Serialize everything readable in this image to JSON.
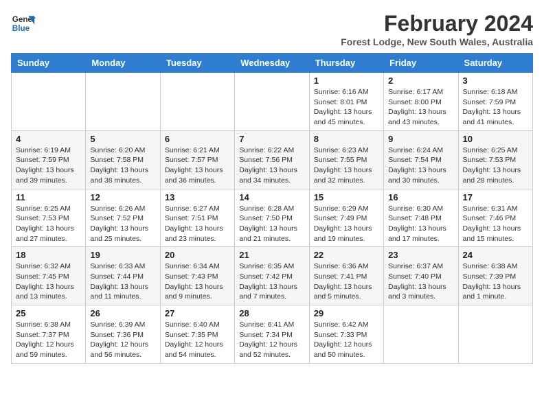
{
  "logo": {
    "line1": "General",
    "line2": "Blue"
  },
  "title": "February 2024",
  "location": "Forest Lodge, New South Wales, Australia",
  "weekdays": [
    "Sunday",
    "Monday",
    "Tuesday",
    "Wednesday",
    "Thursday",
    "Friday",
    "Saturday"
  ],
  "weeks": [
    [
      {
        "day": "",
        "info": ""
      },
      {
        "day": "",
        "info": ""
      },
      {
        "day": "",
        "info": ""
      },
      {
        "day": "",
        "info": ""
      },
      {
        "day": "1",
        "info": "Sunrise: 6:16 AM\nSunset: 8:01 PM\nDaylight: 13 hours\nand 45 minutes."
      },
      {
        "day": "2",
        "info": "Sunrise: 6:17 AM\nSunset: 8:00 PM\nDaylight: 13 hours\nand 43 minutes."
      },
      {
        "day": "3",
        "info": "Sunrise: 6:18 AM\nSunset: 7:59 PM\nDaylight: 13 hours\nand 41 minutes."
      }
    ],
    [
      {
        "day": "4",
        "info": "Sunrise: 6:19 AM\nSunset: 7:59 PM\nDaylight: 13 hours\nand 39 minutes."
      },
      {
        "day": "5",
        "info": "Sunrise: 6:20 AM\nSunset: 7:58 PM\nDaylight: 13 hours\nand 38 minutes."
      },
      {
        "day": "6",
        "info": "Sunrise: 6:21 AM\nSunset: 7:57 PM\nDaylight: 13 hours\nand 36 minutes."
      },
      {
        "day": "7",
        "info": "Sunrise: 6:22 AM\nSunset: 7:56 PM\nDaylight: 13 hours\nand 34 minutes."
      },
      {
        "day": "8",
        "info": "Sunrise: 6:23 AM\nSunset: 7:55 PM\nDaylight: 13 hours\nand 32 minutes."
      },
      {
        "day": "9",
        "info": "Sunrise: 6:24 AM\nSunset: 7:54 PM\nDaylight: 13 hours\nand 30 minutes."
      },
      {
        "day": "10",
        "info": "Sunrise: 6:25 AM\nSunset: 7:53 PM\nDaylight: 13 hours\nand 28 minutes."
      }
    ],
    [
      {
        "day": "11",
        "info": "Sunrise: 6:25 AM\nSunset: 7:53 PM\nDaylight: 13 hours\nand 27 minutes."
      },
      {
        "day": "12",
        "info": "Sunrise: 6:26 AM\nSunset: 7:52 PM\nDaylight: 13 hours\nand 25 minutes."
      },
      {
        "day": "13",
        "info": "Sunrise: 6:27 AM\nSunset: 7:51 PM\nDaylight: 13 hours\nand 23 minutes."
      },
      {
        "day": "14",
        "info": "Sunrise: 6:28 AM\nSunset: 7:50 PM\nDaylight: 13 hours\nand 21 minutes."
      },
      {
        "day": "15",
        "info": "Sunrise: 6:29 AM\nSunset: 7:49 PM\nDaylight: 13 hours\nand 19 minutes."
      },
      {
        "day": "16",
        "info": "Sunrise: 6:30 AM\nSunset: 7:48 PM\nDaylight: 13 hours\nand 17 minutes."
      },
      {
        "day": "17",
        "info": "Sunrise: 6:31 AM\nSunset: 7:46 PM\nDaylight: 13 hours\nand 15 minutes."
      }
    ],
    [
      {
        "day": "18",
        "info": "Sunrise: 6:32 AM\nSunset: 7:45 PM\nDaylight: 13 hours\nand 13 minutes."
      },
      {
        "day": "19",
        "info": "Sunrise: 6:33 AM\nSunset: 7:44 PM\nDaylight: 13 hours\nand 11 minutes."
      },
      {
        "day": "20",
        "info": "Sunrise: 6:34 AM\nSunset: 7:43 PM\nDaylight: 13 hours\nand 9 minutes."
      },
      {
        "day": "21",
        "info": "Sunrise: 6:35 AM\nSunset: 7:42 PM\nDaylight: 13 hours\nand 7 minutes."
      },
      {
        "day": "22",
        "info": "Sunrise: 6:36 AM\nSunset: 7:41 PM\nDaylight: 13 hours\nand 5 minutes."
      },
      {
        "day": "23",
        "info": "Sunrise: 6:37 AM\nSunset: 7:40 PM\nDaylight: 13 hours\nand 3 minutes."
      },
      {
        "day": "24",
        "info": "Sunrise: 6:38 AM\nSunset: 7:39 PM\nDaylight: 13 hours\nand 1 minute."
      }
    ],
    [
      {
        "day": "25",
        "info": "Sunrise: 6:38 AM\nSunset: 7:37 PM\nDaylight: 12 hours\nand 59 minutes."
      },
      {
        "day": "26",
        "info": "Sunrise: 6:39 AM\nSunset: 7:36 PM\nDaylight: 12 hours\nand 56 minutes."
      },
      {
        "day": "27",
        "info": "Sunrise: 6:40 AM\nSunset: 7:35 PM\nDaylight: 12 hours\nand 54 minutes."
      },
      {
        "day": "28",
        "info": "Sunrise: 6:41 AM\nSunset: 7:34 PM\nDaylight: 12 hours\nand 52 minutes."
      },
      {
        "day": "29",
        "info": "Sunrise: 6:42 AM\nSunset: 7:33 PM\nDaylight: 12 hours\nand 50 minutes."
      },
      {
        "day": "",
        "info": ""
      },
      {
        "day": "",
        "info": ""
      }
    ]
  ]
}
